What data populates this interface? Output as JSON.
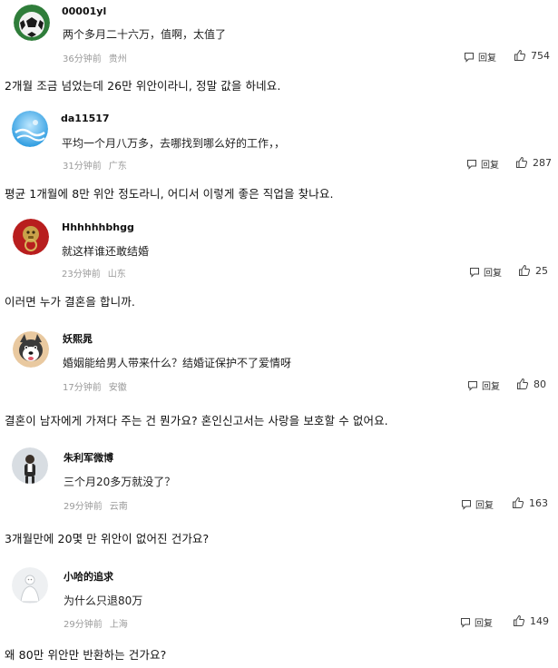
{
  "comments": [
    {
      "username": "00001yl",
      "text": "两个多月二十六万，值啊，太值了",
      "time": "36分钟前",
      "location": "贵州",
      "reply_label": "回复",
      "likes": "754",
      "translation": "2개월 조금 넘었는데 26만 위안이라니, 정말 값을 하네요.",
      "avatar_icon": "soccer-ball-avatar"
    },
    {
      "username": "da11517",
      "text": "平均一个月八万多，去哪找到哪么好的工作，，",
      "time": "31分钟前",
      "location": "广东",
      "reply_label": "回复",
      "likes": "287",
      "translation": "평균 1개월에 8만 위안 정도라니, 어디서 이렇게 좋은 직업을 찾나요.",
      "avatar_icon": "blue-water-avatar"
    },
    {
      "username": "Hhhhhhbhgg",
      "text": "就这样谁还敢结婚",
      "time": "23分钟前",
      "location": "山东",
      "reply_label": "回复",
      "likes": "25",
      "translation": "이러면 누가 결혼을 합니까.",
      "avatar_icon": "lion-door-knocker-avatar"
    },
    {
      "username": "妖熙晁",
      "text": "婚姻能给男人带来什么？结婚证保护不了爱情呀",
      "time": "17分钟前",
      "location": "安徽",
      "reply_label": "回复",
      "likes": "80",
      "translation": "결혼이 남자에게 가져다 주는 건 뭔가요? 혼인신고서는 사랑을 보호할 수 없어요.",
      "avatar_icon": "husky-dog-avatar"
    },
    {
      "username": "朱利军微博",
      "text": "三个月20多万就没了？",
      "time": "29分钟前",
      "location": "云南",
      "reply_label": "回复",
      "likes": "163",
      "translation": "3개월만에 20몇 만 위안이 없어진 건가요?",
      "avatar_icon": "person-portrait-avatar"
    },
    {
      "username": "小哈的追求",
      "text": "为什么只退80万",
      "time": "29分钟前",
      "location": "上海",
      "reply_label": "回复",
      "likes": "149",
      "translation": "왜 80만 위안만 반환하는 건가요?",
      "avatar_icon": "white-figure-avatar"
    }
  ]
}
